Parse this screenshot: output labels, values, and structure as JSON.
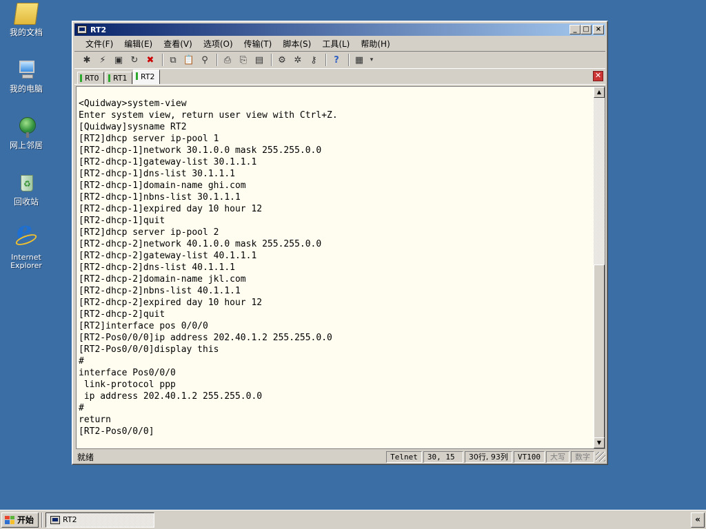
{
  "desktop": {
    "icons": [
      {
        "label": "我的文档",
        "icon": "my-documents-icon"
      },
      {
        "label": "我的电脑",
        "icon": "my-computer-icon"
      },
      {
        "label": "网上邻居",
        "icon": "network-places-icon"
      },
      {
        "label": "回收站",
        "icon": "recycle-bin-icon"
      },
      {
        "label": "Internet Explorer",
        "icon": "internet-explorer-icon"
      }
    ]
  },
  "window": {
    "title": "RT2",
    "controls": {
      "minimize": "_",
      "maximize": "□",
      "close": "×"
    }
  },
  "menu": [
    "文件(F)",
    "编辑(E)",
    "查看(V)",
    "选项(O)",
    "传输(T)",
    "脚本(S)",
    "工具(L)",
    "帮助(H)"
  ],
  "tabs": [
    {
      "label": "RT0"
    },
    {
      "label": "RT1"
    },
    {
      "label": "RT2",
      "active": true
    }
  ],
  "terminal": {
    "lines": [
      "<Quidway>system-view",
      "Enter system view, return user view with Ctrl+Z.",
      "[Quidway]sysname RT2",
      "[RT2]dhcp server ip-pool 1",
      "[RT2-dhcp-1]network 30.1.0.0 mask 255.255.0.0",
      "[RT2-dhcp-1]gateway-list 30.1.1.1",
      "[RT2-dhcp-1]dns-list 30.1.1.1",
      "[RT2-dhcp-1]domain-name ghi.com",
      "[RT2-dhcp-1]nbns-list 30.1.1.1",
      "[RT2-dhcp-1]expired day 10 hour 12",
      "[RT2-dhcp-1]quit",
      "[RT2]dhcp server ip-pool 2",
      "[RT2-dhcp-2]network 40.1.0.0 mask 255.255.0.0",
      "[RT2-dhcp-2]gateway-list 40.1.1.1",
      "[RT2-dhcp-2]dns-list 40.1.1.1",
      "[RT2-dhcp-2]domain-name jkl.com",
      "[RT2-dhcp-2]nbns-list 40.1.1.1",
      "[RT2-dhcp-2]expired day 10 hour 12",
      "[RT2-dhcp-2]quit",
      "[RT2]interface pos 0/0/0",
      "[RT2-Pos0/0/0]ip address 202.40.1.2 255.255.0.0",
      "[RT2-Pos0/0/0]display this",
      "#",
      "interface Pos0/0/0",
      " link-protocol ppp",
      " ip address 202.40.1.2 255.255.0.0",
      "#",
      "return",
      "[RT2-Pos0/0/0]"
    ]
  },
  "status": {
    "main": "就绪",
    "protocol": "Telnet",
    "cursor": "30,  15",
    "size": "30行, 93列",
    "emulation": "VT100",
    "caps": "大写",
    "num": "数字"
  },
  "taskbar": {
    "start_label": "开始",
    "task_label": "RT2",
    "tray_toggle": "«"
  }
}
